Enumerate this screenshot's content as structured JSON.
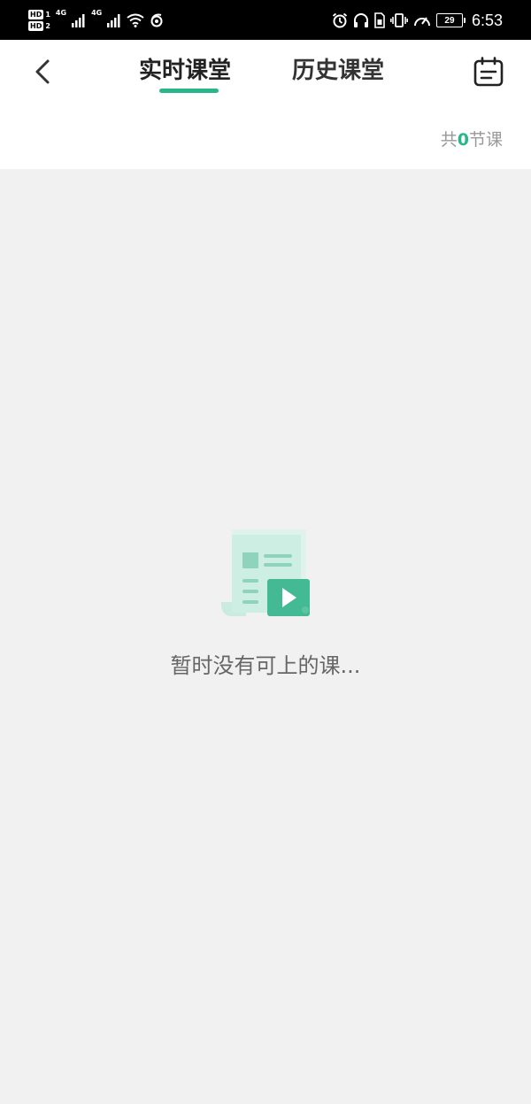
{
  "status_bar": {
    "sim1": "HD",
    "sim1_index": "1",
    "sim2": "HD",
    "sim2_index": "2",
    "net1": "4G",
    "net2": "4G",
    "battery": "29",
    "time": "6:53"
  },
  "header": {
    "tabs": [
      {
        "label": "实时课堂",
        "active": true
      },
      {
        "label": "历史课堂",
        "active": false
      }
    ],
    "accent_color": "#2bb58a"
  },
  "lesson_count": {
    "prefix": "共",
    "count": "0",
    "suffix": "节课"
  },
  "empty_state": {
    "message": "暂时没有可上的课..."
  },
  "icons": {
    "back": "chevron-left-icon",
    "calendar": "calendar-icon",
    "empty": "course-video-document-icon"
  }
}
